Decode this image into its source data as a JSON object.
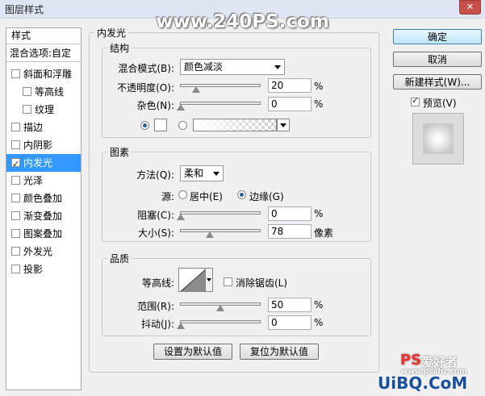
{
  "window": {
    "title": "图层样式",
    "close": "✕"
  },
  "watermark": "www.240PS.com",
  "sidebar": {
    "header": "样式",
    "blend_options": "混合选项:自定",
    "items": [
      {
        "label": "斜面和浮雕",
        "checked": false
      },
      {
        "label": "等高线",
        "checked": false
      },
      {
        "label": "纹理",
        "checked": false
      },
      {
        "label": "描边",
        "checked": false
      },
      {
        "label": "内阴影",
        "checked": false
      },
      {
        "label": "内发光",
        "checked": true
      },
      {
        "label": "光泽",
        "checked": false
      },
      {
        "label": "颜色叠加",
        "checked": false
      },
      {
        "label": "渐变叠加",
        "checked": false
      },
      {
        "label": "图案叠加",
        "checked": false
      },
      {
        "label": "外发光",
        "checked": false
      },
      {
        "label": "投影",
        "checked": false
      }
    ]
  },
  "panel": {
    "title": "内发光",
    "structure": {
      "legend": "结构",
      "blend_mode_label": "混合模式(B):",
      "blend_mode_value": "颜色减淡",
      "opacity_label": "不透明度(O):",
      "opacity_value": "20",
      "noise_label": "杂色(N):",
      "noise_value": "0",
      "unit": "%"
    },
    "elements": {
      "legend": "图素",
      "method_label": "方法(Q):",
      "method_value": "柔和",
      "source_label": "源:",
      "source_center": "居中(E)",
      "source_edge": "边缘(G)",
      "choke_label": "阻塞(C):",
      "choke_value": "0",
      "size_label": "大小(S):",
      "size_value": "78",
      "size_unit": "像素",
      "unit": "%"
    },
    "quality": {
      "legend": "品质",
      "contour_label": "等高线:",
      "antialias_label": "消除锯齿(L)",
      "range_label": "范围(R):",
      "range_value": "50",
      "jitter_label": "抖动(J):",
      "jitter_value": "0",
      "unit": "%"
    },
    "make_default": "设置为默认值",
    "reset_default": "复位为默认值"
  },
  "buttons": {
    "ok": "确定",
    "cancel": "取消",
    "new_style": "新建样式(W)...",
    "preview": "预览(V)"
  },
  "footer_brand": {
    "ps_logo": "PS",
    "site_cn": "爱好者",
    "url": "www.psahz.com",
    "uibq": "UiBQ.CoM"
  }
}
